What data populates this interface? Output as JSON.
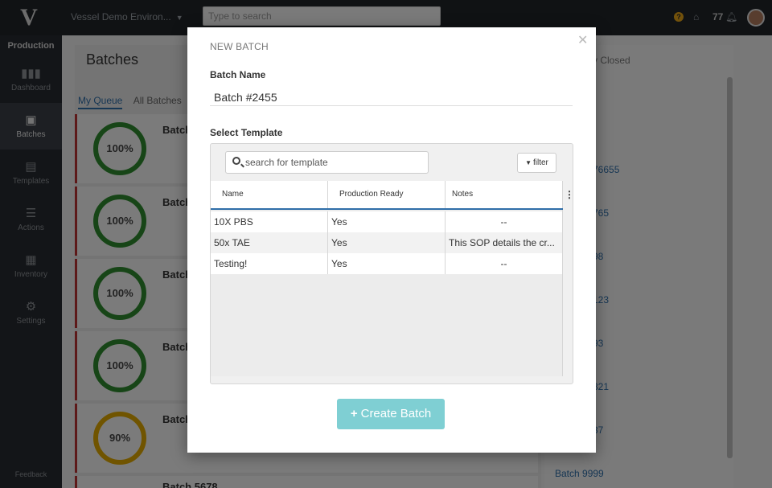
{
  "topbar": {
    "logo": "V",
    "environment": "Vessel Demo Environ...",
    "search_placeholder": "Type to search",
    "help_icon": "?",
    "notification_count": "77"
  },
  "sidebar": {
    "section": "Production",
    "items": [
      {
        "label": "Dashboard",
        "icon": "bar-chart-icon",
        "glyph": "▮▮▮"
      },
      {
        "label": "Batches",
        "icon": "batches-icon",
        "glyph": "▣"
      },
      {
        "label": "Templates",
        "icon": "templates-icon",
        "glyph": "▤"
      },
      {
        "label": "Actions",
        "icon": "sliders-icon",
        "glyph": "☰"
      },
      {
        "label": "Inventory",
        "icon": "inventory-icon",
        "glyph": "▦"
      },
      {
        "label": "Settings",
        "icon": "gear-icon",
        "glyph": "⚙"
      }
    ],
    "feedback": "Feedback"
  },
  "background": {
    "title": "Batches",
    "tabs": [
      "My Queue",
      "All Batches"
    ],
    "cards": [
      {
        "title": "Batch",
        "progress": "100%"
      },
      {
        "title": "Batch",
        "progress": "100%"
      },
      {
        "title": "Batch",
        "progress": "100%"
      },
      {
        "title": "Batch",
        "progress": "100%"
      },
      {
        "title": "Batch",
        "progress": "90%"
      },
      {
        "title": "Batch 5678",
        "progress": ""
      }
    ],
    "right_header": "y Closed",
    "right_links": [
      "76655",
      "765",
      "98",
      "123",
      "93",
      "821",
      "37",
      "Batch 9999"
    ]
  },
  "modal": {
    "title": "NEW BATCH",
    "batch_name_label": "Batch Name",
    "batch_name_value": "Batch #2455",
    "select_template_label": "Select Template",
    "search_placeholder": "search for template",
    "filter_label": "filter",
    "columns": [
      "Name",
      "Production Ready",
      "Notes"
    ],
    "rows": [
      {
        "name": "10X PBS",
        "ready": "Yes",
        "notes": "--"
      },
      {
        "name": "50x TAE",
        "ready": "Yes",
        "notes": "This SOP details the cr..."
      },
      {
        "name": "Testing!",
        "ready": "Yes",
        "notes": "--"
      }
    ],
    "create_label": "Create Batch",
    "colors": {
      "accent": "#2f6ea9",
      "create_button": "#7fcfd3"
    }
  }
}
